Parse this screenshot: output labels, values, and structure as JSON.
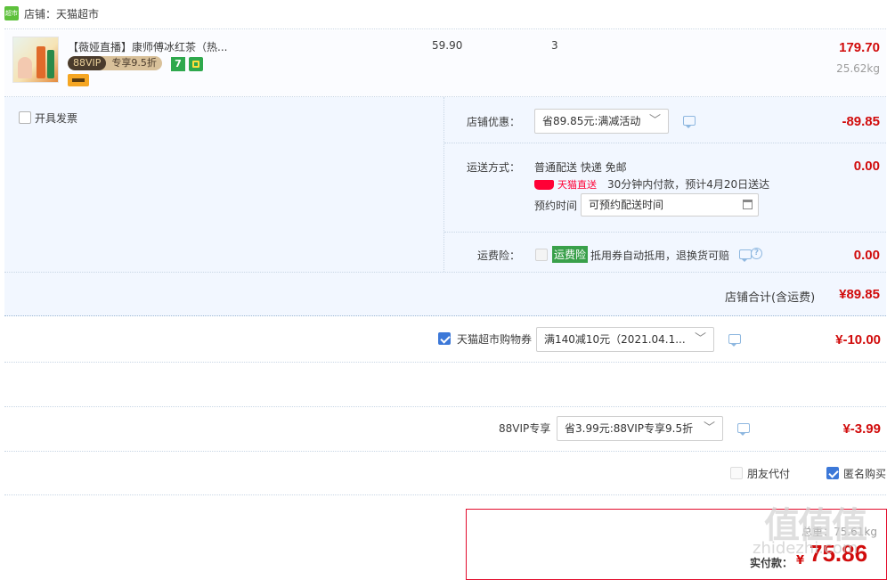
{
  "shop": {
    "label": "店铺：天猫超市",
    "logo_text": "超市"
  },
  "item": {
    "title": "【薇娅直播】康师傅冰红茶（热...",
    "vip_badge": "88VIP",
    "vip_discount": "专享9.5折",
    "badge_seven": "7",
    "price": "59.90",
    "quantity": "3",
    "subtotal": "179.70",
    "weight": "25.62kg"
  },
  "invoice": {
    "label": "开具发票"
  },
  "shop_discount": {
    "label": "店铺优惠：",
    "value": "省89.85元:满减活动",
    "amount": "-89.85"
  },
  "shipping": {
    "label": "运送方式：",
    "method": "普通配送 快递 免邮",
    "tmall_direct": "天猫直送",
    "note": "30分钟内付款，预计4月20日送达",
    "schedule_label": "预约时间",
    "schedule_value": "可预约配送时间",
    "amount": "0.00"
  },
  "insurance": {
    "label": "运费险：",
    "tag": "运费险",
    "desc": "抵用券自动抵用，退换货可赔",
    "amount": "0.00"
  },
  "shop_total": {
    "label": "店铺合计(含运费)",
    "amount": "¥89.85"
  },
  "coupon": {
    "label": "天猫超市购物券",
    "value": "满140减10元（2021.04.1...",
    "amount": "¥-10.00"
  },
  "vip88": {
    "label": "88VIP专享",
    "value": "省3.99元:88VIP专享9.5折",
    "amount": "¥-3.99"
  },
  "options": {
    "friend_pay": "朋友代付",
    "anonymous": "匿名购买"
  },
  "summary": {
    "weight": "总重：75.61kg",
    "pay_label": "实付款：",
    "currency": "¥",
    "amount": "75.86"
  },
  "watermark": {
    "text": "zhidezhi.com"
  },
  "colors": {
    "accent_red": "#d10c0c",
    "panel_blue": "#f2f7ff",
    "check_blue": "#3c78d8",
    "tmall_red": "#ff0036"
  }
}
